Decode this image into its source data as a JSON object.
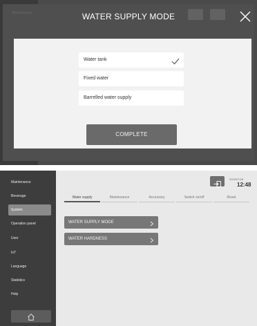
{
  "modal_screen": {
    "background_label": "Maintenance",
    "title": "WATER SUPPLY MODE",
    "options": [
      {
        "label": "Water tank",
        "selected": true
      },
      {
        "label": "Fixed water",
        "selected": false
      },
      {
        "label": "Barrelled water supply",
        "selected": false
      }
    ],
    "complete_label": "COMPLETE",
    "icons": {
      "close": "close-icon",
      "check": "check-icon"
    }
  },
  "settings_screen": {
    "sidebar": {
      "items": [
        {
          "label": "Maintenance"
        },
        {
          "label": "Beverage"
        },
        {
          "label": "System",
          "active": true
        },
        {
          "label": "Operation panel"
        },
        {
          "label": "User"
        },
        {
          "label": "IoT"
        },
        {
          "label": "Language"
        },
        {
          "label": "Statistics"
        },
        {
          "label": "Help"
        }
      ],
      "home_icon": "home-icon"
    },
    "header": {
      "date": "2022/07/18",
      "time": "12:48",
      "exit_icon": "exit-icon"
    },
    "tabs": [
      {
        "label": "Water supply",
        "active": true
      },
      {
        "label": "Maintenance"
      },
      {
        "label": "Accessory"
      },
      {
        "label": "Switch on/off"
      },
      {
        "label": "Reset"
      }
    ],
    "menu_items": [
      {
        "label": "WATER SUPPLY MODE"
      },
      {
        "label": "WATER HARDNESS"
      }
    ]
  },
  "colors": {
    "modal_backdrop": "#4a4a4a",
    "dialog": "#f2f2f2",
    "complete_button": "#6a6a6a",
    "sidebar": "#3d3d3d",
    "sidebar_active": "#8a8a8a",
    "menu_button": "#777777",
    "main_background": "#e9e9e9"
  }
}
